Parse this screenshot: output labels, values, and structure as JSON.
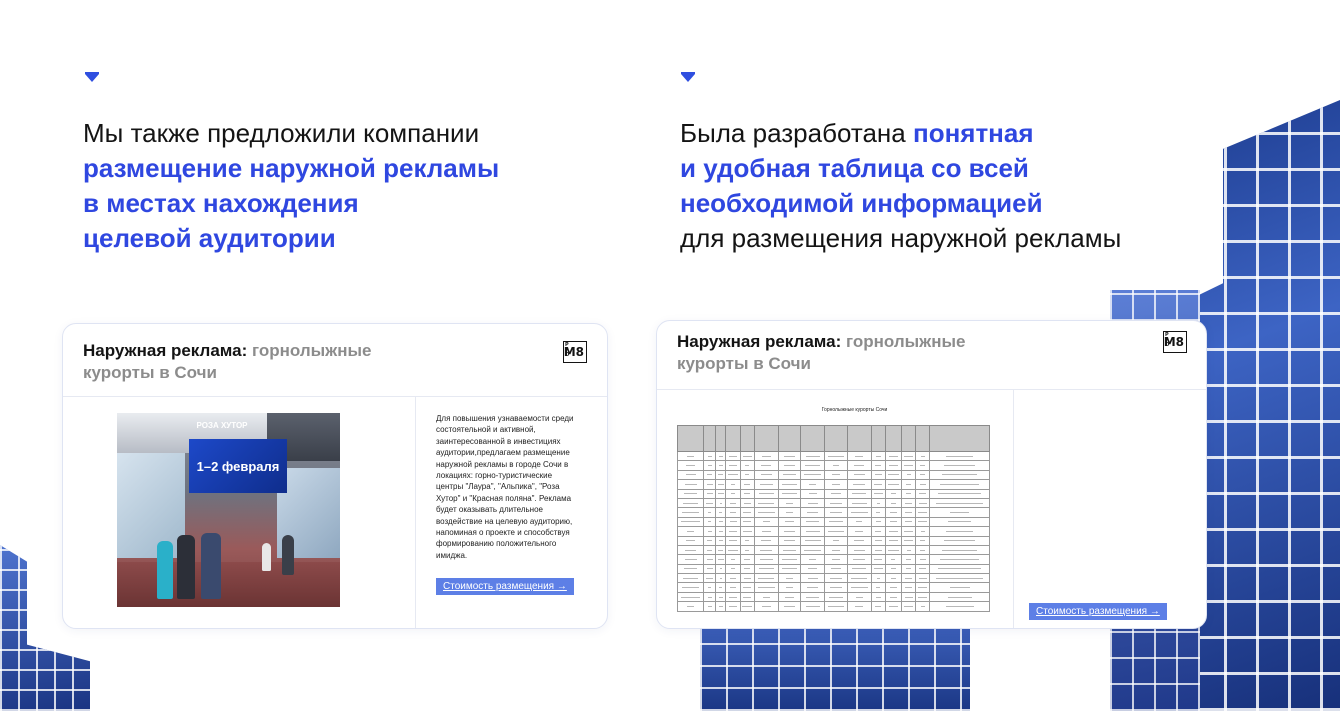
{
  "left": {
    "heading": {
      "line1": "Мы также предложили компании",
      "line2": "размещение наружной рекламы",
      "line3": "в местах нахождения",
      "line4": "целевой аудитории"
    },
    "card": {
      "title_bold": "Наружная реклама:",
      "title_grey_1": "горнолыжные",
      "title_grey_2": "курорты в Сочи",
      "logo_text": "M8",
      "logo_small": "PRO",
      "photo": {
        "brand": "РОЗА ХУТОР",
        "screen_text": "1–2 февраля"
      },
      "description": "Для повышения узнаваемости среди состоятельной и активной, заинтересованной в инвестициях аудитории,предлагаем размещение наружной рекламы в городе Сочи в локациях: горно-туристические центры \"Лаура\", \"Альпика\", \"Роза Хутор\" и \"Красная поляна\". Реклама будет оказывать длительное воздействие на целевую аудиторию, напоминая о проекте и способствуя формированию положительного имиджа.",
      "button_label": "Стоимость размещения  →"
    }
  },
  "right": {
    "heading": {
      "line1_plain": "Была разработана ",
      "line1_accent": "понятная",
      "line2": "и удобная таблица со всей",
      "line3": "необходимой информацией",
      "line4": "для размещения наружной рекламы"
    },
    "card": {
      "title_bold": "Наружная реклама:",
      "title_grey_1": "горнолыжные",
      "title_grey_2": "курорты в Сочи",
      "logo_text": "M8",
      "logo_small": "PRO",
      "table_title": "Горнолыжные курорты Сочи",
      "button_label": "Стоимость размещения  →"
    }
  },
  "colors": {
    "accent": "#2f47e0",
    "button": "#5d7fe6",
    "grey_title": "#8c8c8c"
  }
}
